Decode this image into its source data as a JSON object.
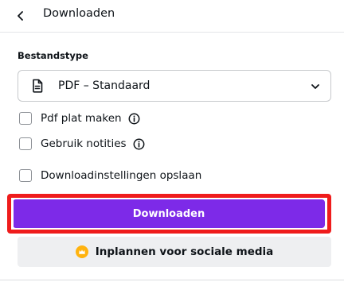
{
  "header": {
    "title": "Downloaden"
  },
  "file_type": {
    "section_label": "Bestandstype",
    "selected": "PDF – Standaard"
  },
  "options": {
    "flatten_pdf": {
      "label": "Pdf plat maken",
      "checked": false
    },
    "use_notes": {
      "label": "Gebruik notities",
      "checked": false
    },
    "save_settings": {
      "label": "Downloadinstellingen opslaan",
      "checked": false
    }
  },
  "actions": {
    "download_label": "Downloaden",
    "schedule_label": "Inplannen voor sociale media"
  },
  "colors": {
    "primary": "#7d2ae8",
    "highlight": "#ef1c1c",
    "crown": "#ffb30f"
  },
  "icons": {
    "back": "chevron-left-icon",
    "doc": "document-icon",
    "dropdown": "chevron-down-icon",
    "info": "info-icon",
    "crown": "crown-icon"
  }
}
